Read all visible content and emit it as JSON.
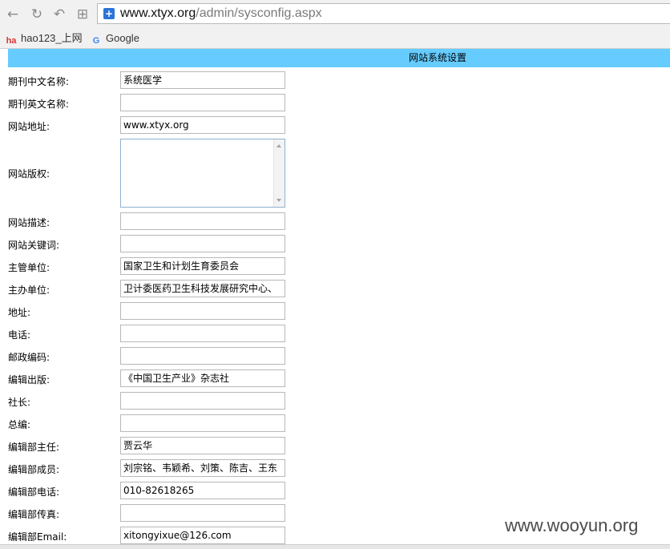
{
  "browser": {
    "url_host": "www.xtyx.org",
    "url_path": "/admin/sysconfig.aspx",
    "bookmarks": [
      {
        "label": "hao123_上网",
        "icon": "hao123-icon"
      },
      {
        "label": "Google",
        "icon": "google-icon"
      }
    ]
  },
  "page": {
    "header": "网站系统设置"
  },
  "form": {
    "fields": [
      {
        "label": "期刊中文名称:",
        "value": "系统医学"
      },
      {
        "label": "期刊英文名称:",
        "value": ""
      },
      {
        "label": "网站地址:",
        "value": "www.xtyx.org"
      },
      {
        "label": "网站版权:",
        "value": ""
      },
      {
        "label": "网站描述:",
        "value": ""
      },
      {
        "label": "网站关键词:",
        "value": ""
      },
      {
        "label": "主管单位:",
        "value": "国家卫生和计划生育委员会"
      },
      {
        "label": "主办单位:",
        "value": "卫计委医药卫生科技发展研究中心、"
      },
      {
        "label": "地址:",
        "value": ""
      },
      {
        "label": "电话:",
        "value": ""
      },
      {
        "label": "邮政编码:",
        "value": ""
      },
      {
        "label": "编辑出版:",
        "value": "《中国卫生产业》杂志社"
      },
      {
        "label": "社长:",
        "value": ""
      },
      {
        "label": "总编:",
        "value": ""
      },
      {
        "label": "编辑部主任:",
        "value": "贾云华"
      },
      {
        "label": "编辑部成员:",
        "value": "刘宗铭、韦颖希、刘策、陈吉、王东"
      },
      {
        "label": "编辑部电话:",
        "value": "010-82618265"
      },
      {
        "label": "编辑部传真:",
        "value": ""
      },
      {
        "label": "编辑部Email:",
        "value": "xitongyixue@126.com"
      }
    ]
  },
  "watermark": "www.wooyun.org"
}
